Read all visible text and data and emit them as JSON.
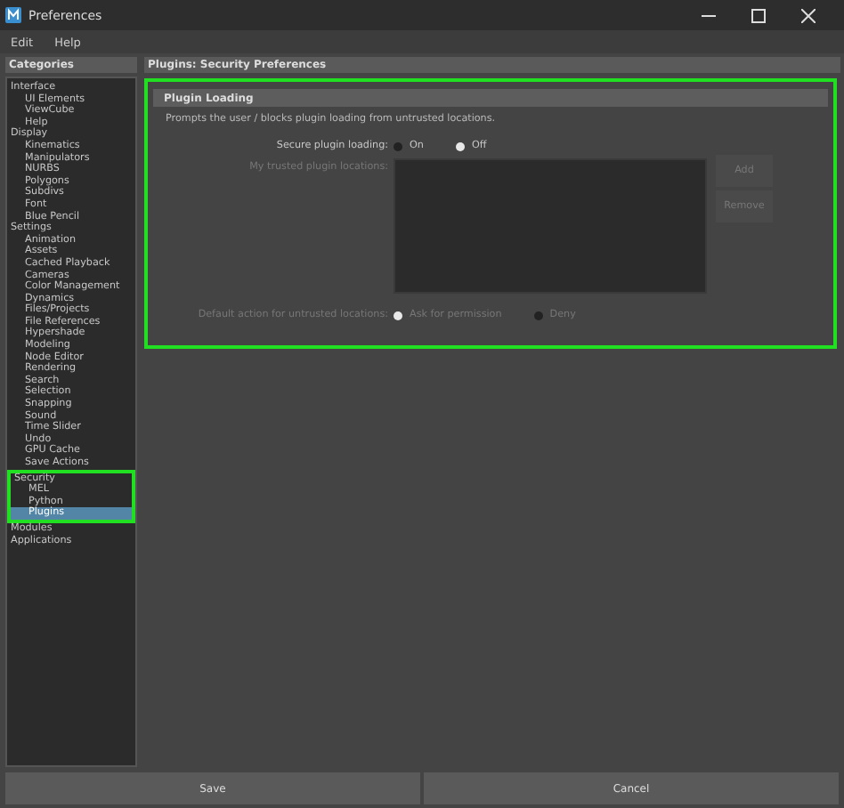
{
  "window": {
    "title": "Preferences"
  },
  "menu": [
    "Edit",
    "Help"
  ],
  "categories": {
    "title": "Categories",
    "items": [
      {
        "label": "Interface",
        "selected": false,
        "highlighted": false,
        "children": [
          {
            "label": "UI Elements",
            "selected": false
          },
          {
            "label": "ViewCube",
            "selected": false
          },
          {
            "label": "Help",
            "selected": false
          }
        ]
      },
      {
        "label": "Display",
        "selected": false,
        "highlighted": false,
        "children": [
          {
            "label": "Kinematics",
            "selected": false
          },
          {
            "label": "Manipulators",
            "selected": false
          },
          {
            "label": "NURBS",
            "selected": false
          },
          {
            "label": "Polygons",
            "selected": false
          },
          {
            "label": "Subdivs",
            "selected": false
          },
          {
            "label": "Font",
            "selected": false
          },
          {
            "label": "Blue Pencil",
            "selected": false
          }
        ]
      },
      {
        "label": "Settings",
        "selected": false,
        "highlighted": false,
        "children": [
          {
            "label": "Animation",
            "selected": false
          },
          {
            "label": "Assets",
            "selected": false
          },
          {
            "label": "Cached Playback",
            "selected": false
          },
          {
            "label": "Cameras",
            "selected": false
          },
          {
            "label": "Color Management",
            "selected": false
          },
          {
            "label": "Dynamics",
            "selected": false
          },
          {
            "label": "Files/Projects",
            "selected": false
          },
          {
            "label": "File References",
            "selected": false
          },
          {
            "label": "Hypershade",
            "selected": false
          },
          {
            "label": "Modeling",
            "selected": false
          },
          {
            "label": "Node Editor",
            "selected": false
          },
          {
            "label": "Rendering",
            "selected": false
          },
          {
            "label": "Search",
            "selected": false
          },
          {
            "label": "Selection",
            "selected": false
          },
          {
            "label": "Snapping",
            "selected": false
          },
          {
            "label": "Sound",
            "selected": false
          },
          {
            "label": "Time Slider",
            "selected": false
          },
          {
            "label": "Undo",
            "selected": false
          },
          {
            "label": "GPU Cache",
            "selected": false
          },
          {
            "label": "Save Actions",
            "selected": false
          }
        ]
      },
      {
        "label": "Security",
        "selected": false,
        "highlighted": true,
        "children": [
          {
            "label": "MEL",
            "selected": false
          },
          {
            "label": "Python",
            "selected": false
          },
          {
            "label": "Plugins",
            "selected": true
          }
        ]
      },
      {
        "label": "Modules",
        "selected": false,
        "highlighted": false
      },
      {
        "label": "Applications",
        "selected": false,
        "highlighted": false
      }
    ]
  },
  "panel": {
    "title": "Plugins: Security Preferences",
    "section": {
      "title": "Plugin Loading",
      "highlighted": true,
      "description": "Prompts the user / blocks plugin loading from untrusted locations.",
      "secure_loading": {
        "label": "Secure plugin loading:",
        "options": [
          {
            "label": "On",
            "selected": false
          },
          {
            "label": "Off",
            "selected": true
          }
        ]
      },
      "trusted_locations": {
        "label": "My trusted plugin locations:",
        "disabled": true,
        "buttons": [
          {
            "label": "Add",
            "disabled": true
          },
          {
            "label": "Remove",
            "disabled": true
          }
        ]
      },
      "default_action": {
        "label": "Default action for untrusted locations:",
        "disabled": true,
        "options": [
          {
            "label": "Ask for permission",
            "selected": true
          },
          {
            "label": "Deny",
            "selected": false
          }
        ]
      }
    }
  },
  "buttons": [
    "Save",
    "Cancel"
  ]
}
